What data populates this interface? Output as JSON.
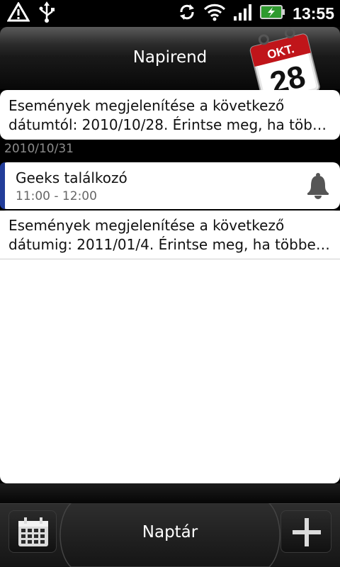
{
  "status_bar": {
    "time": "13:55",
    "icons": [
      "warning-icon",
      "usb-icon",
      "sync-icon",
      "wifi-icon",
      "signal-icon",
      "battery-icon"
    ]
  },
  "header": {
    "title": "Napirend",
    "calendar_month": "OKT.",
    "calendar_day": "28"
  },
  "list": {
    "top_card": {
      "line1": "Események megjelenítése a következő",
      "line2": "dátumtól: 2010/10/28. Érintse meg, ha több..."
    },
    "date_header": "2010/10/31",
    "event": {
      "title": "Geeks találkozó",
      "time": "11:00 - 12:00"
    },
    "bottom_card": {
      "line1": "Események megjelenítése a következő",
      "line2": "dátumig: 2011/01/4. Érintse meg, ha többet ..."
    }
  },
  "bottom_bar": {
    "label": "Naptár"
  },
  "colors": {
    "event_accent": "#223d99",
    "calendar_red": "#c0151a"
  }
}
